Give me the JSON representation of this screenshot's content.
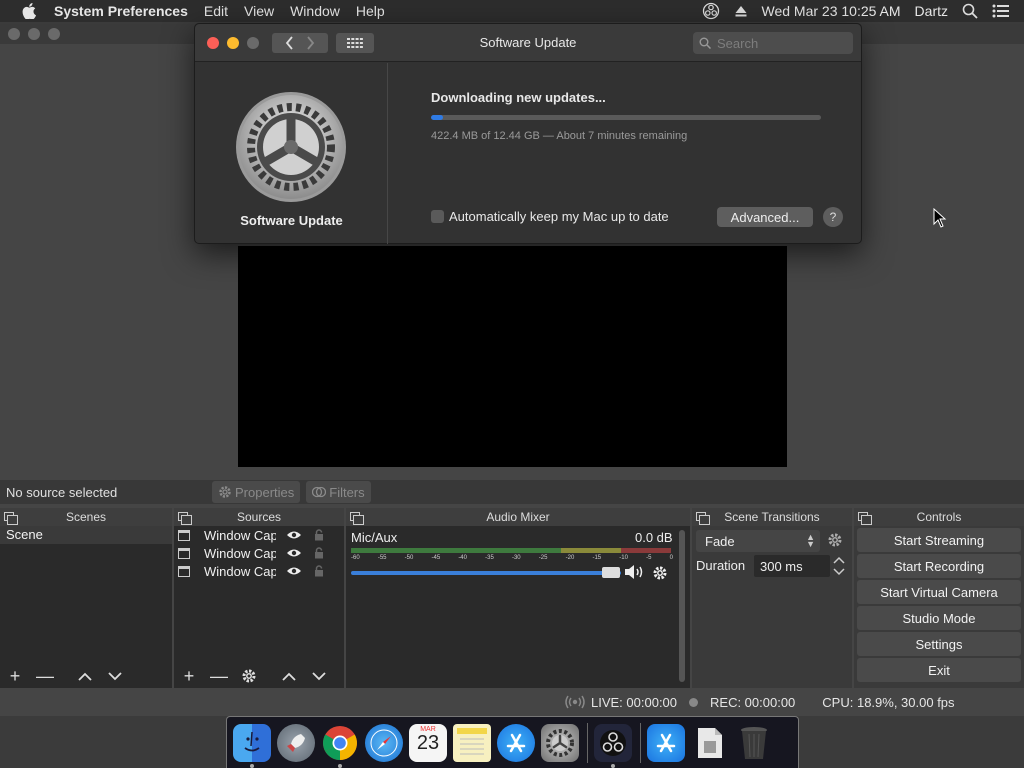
{
  "menubar": {
    "app_name": "System Preferences",
    "items": [
      "Edit",
      "View",
      "Window",
      "Help"
    ],
    "datetime": "Wed Mar 23  10:25 AM",
    "user": "Dartz"
  },
  "software_update": {
    "window_title": "Software Update",
    "search_placeholder": "Search",
    "pane_label": "Software Update",
    "status": "Downloading new updates...",
    "progress_fraction": 0.03,
    "progress_text": "422.4 MB of 12.44 GB — About 7 minutes remaining",
    "auto_update_label": "Automatically keep my Mac up to date",
    "auto_update_checked": false,
    "advanced_button": "Advanced...",
    "help_button": "?"
  },
  "obs": {
    "no_source": "No source selected",
    "properties_button": "Properties",
    "filters_button": "Filters",
    "panels": {
      "scenes": "Scenes",
      "sources": "Sources",
      "audio_mixer": "Audio Mixer",
      "scene_transitions": "Scene Transitions",
      "controls": "Controls"
    },
    "scenes": [
      "Scene"
    ],
    "sources": [
      "Window Capture",
      "Window Capture",
      "Window Capture"
    ],
    "audio": {
      "channel": "Mic/Aux",
      "level": "0.0 dB",
      "ticks": [
        "-60",
        "-55",
        "-50",
        "-45",
        "-40",
        "-35",
        "-30",
        "-25",
        "-20",
        "-15",
        "-10",
        "-5",
        "0"
      ]
    },
    "transitions": {
      "selected": "Fade",
      "duration_label": "Duration",
      "duration_value": "300 ms"
    },
    "controls": [
      "Start Streaming",
      "Start Recording",
      "Start Virtual Camera",
      "Studio Mode",
      "Settings",
      "Exit"
    ],
    "status": {
      "live": "LIVE: 00:00:00",
      "rec": "REC: 00:00:00",
      "cpu": "CPU: 18.9%, 30.00 fps"
    }
  },
  "dock": {
    "calendar_month": "MAR",
    "calendar_day": "23",
    "apps": [
      "finder",
      "launchpad",
      "chrome",
      "safari",
      "calendar",
      "notes",
      "app-store",
      "system-preferences",
      "obs",
      "app-store-2",
      "file",
      "trash"
    ]
  }
}
